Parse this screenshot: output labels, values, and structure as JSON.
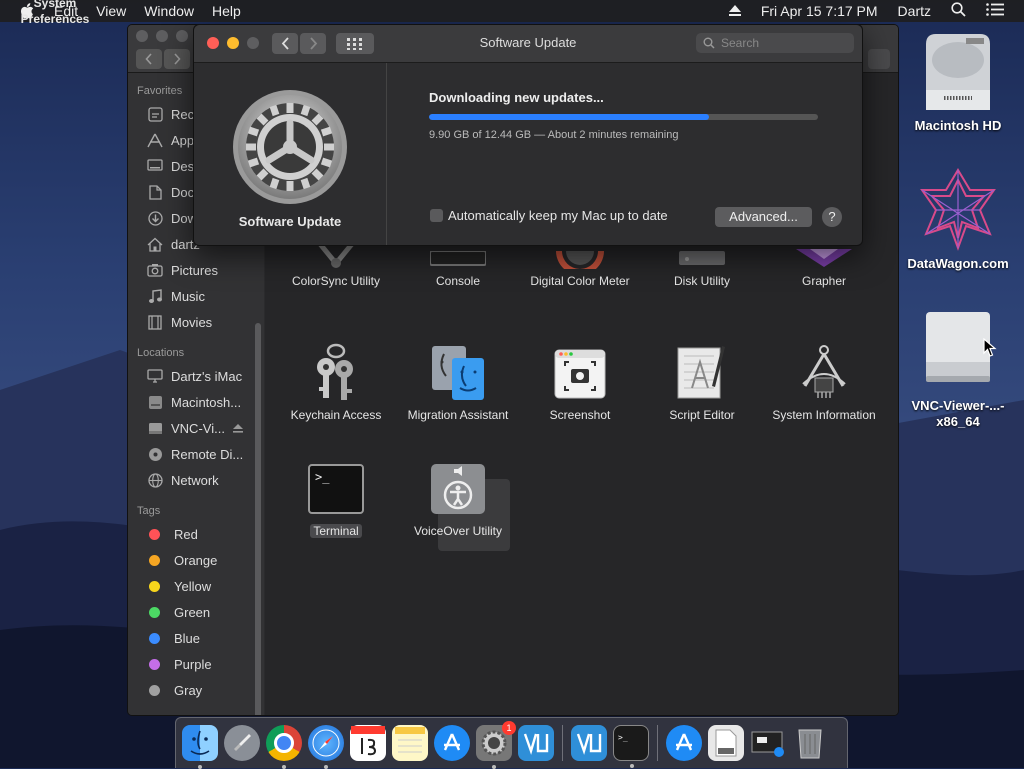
{
  "menubar": {
    "app_name": "System Preferences",
    "items": [
      "Edit",
      "View",
      "Window",
      "Help"
    ],
    "datetime": "Fri Apr 15  7:17 PM",
    "user": "Dartz"
  },
  "finder": {
    "sections": {
      "favorites": "Favorites",
      "locations": "Locations",
      "tags": "Tags"
    },
    "favorites": [
      "Rece",
      "App",
      "Des",
      "Doc",
      "Dow",
      "dartz",
      "Pictures",
      "Music",
      "Movies"
    ],
    "locations": [
      "Dartz's iMac",
      "Macintosh...",
      "VNC-Vi...",
      "Remote Di...",
      "Network"
    ],
    "tags": [
      {
        "label": "Red",
        "color": "#ff5257"
      },
      {
        "label": "Orange",
        "color": "#f5a623"
      },
      {
        "label": "Yellow",
        "color": "#f7d51c"
      },
      {
        "label": "Green",
        "color": "#4cd964"
      },
      {
        "label": "Blue",
        "color": "#3b8cff"
      },
      {
        "label": "Purple",
        "color": "#c56ee8"
      },
      {
        "label": "Gray",
        "color": "#a0a0a0"
      }
    ],
    "apps": [
      {
        "label": "ColorSync Utility",
        "icon": "colorsync-icon"
      },
      {
        "label": "Console",
        "icon": "console-icon"
      },
      {
        "label": "Digital Color Meter",
        "icon": "digital-color-meter-icon"
      },
      {
        "label": "Disk Utility",
        "icon": "disk-utility-icon"
      },
      {
        "label": "Grapher",
        "icon": "grapher-icon"
      },
      {
        "label": "Keychain Access",
        "icon": "keychain-icon"
      },
      {
        "label": "Migration Assistant",
        "icon": "migration-icon"
      },
      {
        "label": "Screenshot",
        "icon": "screenshot-icon"
      },
      {
        "label": "Script Editor",
        "icon": "script-editor-icon"
      },
      {
        "label": "System Information",
        "icon": "system-information-icon"
      },
      {
        "label": "Terminal",
        "icon": "terminal-icon"
      },
      {
        "label": "VoiceOver Utility",
        "icon": "voiceover-icon"
      }
    ]
  },
  "software_update": {
    "window_title": "Software Update",
    "search_placeholder": "Search",
    "pane_name": "Software Update",
    "status": "Downloading new updates...",
    "progress": 0.72,
    "detail": "9.90 GB of 12.44 GB — About 2 minutes remaining",
    "auto_update_label": "Automatically keep my Mac up to date",
    "advanced_label": "Advanced...",
    "help_label": "?"
  },
  "desktop": {
    "icons": [
      "Macintosh HD",
      "DataWagon.com",
      "VNC-Viewer-...-x86_64"
    ]
  },
  "dock": {
    "badge": "1"
  },
  "colors": {
    "accent": "#2a7fff",
    "close": "#ff5f57",
    "minimize": "#febc2e"
  }
}
